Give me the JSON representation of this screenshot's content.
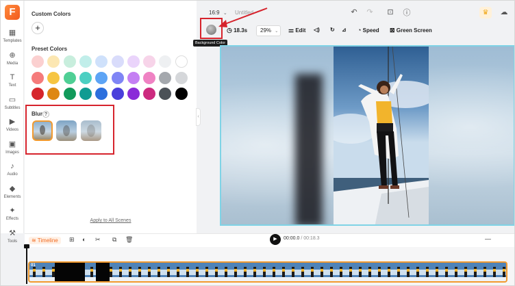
{
  "header": {
    "aspect_ratio": "16:9",
    "title": "Untitled"
  },
  "rail": {
    "items": [
      {
        "label": "Templates",
        "icon": "templates-icon"
      },
      {
        "label": "Media",
        "icon": "media-icon"
      },
      {
        "label": "Text",
        "icon": "text-icon"
      },
      {
        "label": "Subtitles",
        "icon": "subtitles-icon"
      },
      {
        "label": "Videos",
        "icon": "videos-icon"
      },
      {
        "label": "Images",
        "icon": "images-icon"
      },
      {
        "label": "Audio",
        "icon": "audio-icon"
      },
      {
        "label": "Elements",
        "icon": "elements-icon"
      },
      {
        "label": "Effects",
        "icon": "effects-icon"
      },
      {
        "label": "Tools",
        "icon": "tools-icon"
      }
    ]
  },
  "panel": {
    "custom_title": "Custom Colors",
    "add_label": "+",
    "preset_title": "Preset Colors",
    "preset_colors": [
      "#fbd0d0",
      "#fce7b2",
      "#c8eedd",
      "#c1eeea",
      "#cfe1fb",
      "#d9dcfb",
      "#ead4fb",
      "#f7d4e9",
      "#eef0f2",
      "#ffffff",
      "#f57b7b",
      "#f6c542",
      "#4fcf95",
      "#4ccfc2",
      "#5da4f5",
      "#7f85f5",
      "#c47ff3",
      "#ef82c3",
      "#a4a8ad",
      "#d5d7da",
      "#d6262c",
      "#de8713",
      "#119a5b",
      "#109b92",
      "#2c6fdd",
      "#4a3fdb",
      "#8a2cd8",
      "#cc2a7f",
      "#4b5157",
      "#000000"
    ],
    "blur_title": "Blur",
    "help_label": "?",
    "blur_thumbs": 3,
    "apply_label": "Apply to All Scenes"
  },
  "toolbar": {
    "duration": "18.3s",
    "zoom": "29%",
    "edit_label": "Edit",
    "speed_label": "Speed",
    "green_screen_label": "Green Screen",
    "tooltip": "Background Color"
  },
  "timeline": {
    "label": "Timeline",
    "current_time": "00:00.0",
    "total_time": "/ 00:18.3",
    "clip_index": "01"
  },
  "colors": {
    "accent": "#f26b21",
    "annotation_red": "#d6232c",
    "canvas_outline": "#7fd3e6",
    "clip_border": "#f29a2e"
  }
}
